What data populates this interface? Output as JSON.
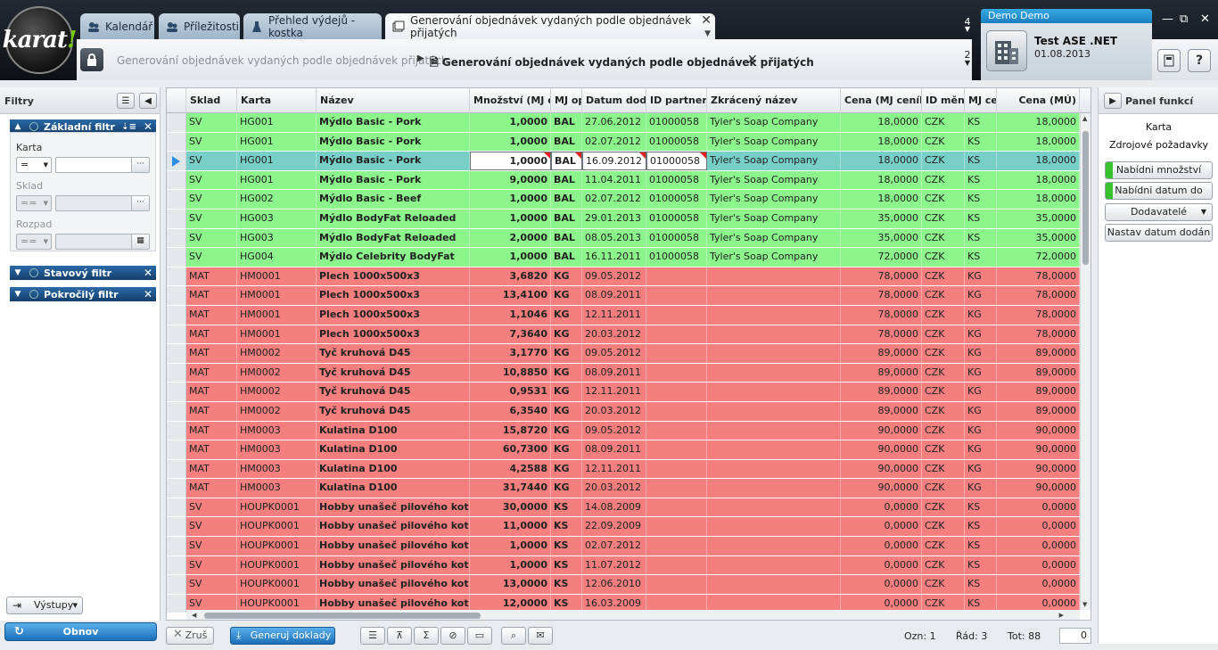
{
  "app": {
    "logo_text": "karat",
    "tabs": [
      {
        "label": "Kalendář",
        "icon": "people-icon"
      },
      {
        "label": "Příležitosti",
        "icon": "people-icon"
      },
      {
        "label": "Přehled výdejů - kostka",
        "icon": "flask-icon"
      },
      {
        "label": "Generování objednávek vydaných podle objednávek přijatých",
        "icon": "window-icon",
        "close": "✕",
        "arrow": "▼"
      }
    ],
    "tab_count": "4",
    "crumb_count": "2",
    "breadcrumb": {
      "parent": "Generování objednávek vydaných podle objednávek přijatých",
      "current": "Generování objednávek vydaných podle objednávek přijatých",
      "close": "✕"
    },
    "user": {
      "name": "Demo Demo",
      "company": "Test ASE .NET",
      "date": "01.08.2013"
    },
    "window_controls": {
      "minimize": "—",
      "restore": "⧉",
      "close": "✕"
    },
    "help": "?"
  },
  "filters": {
    "title": "Filtry",
    "basic": {
      "title": "Základní filtr",
      "fields": [
        {
          "label": "Karta",
          "operator": "=",
          "value": "",
          "disabled": false,
          "button": "···"
        },
        {
          "label": "Sklad",
          "operator": "==",
          "value": "",
          "disabled": true,
          "button": "···"
        },
        {
          "label": "Rozpad",
          "operator": "==",
          "value": "",
          "disabled": true,
          "button": "▦"
        }
      ]
    },
    "state": {
      "title": "Stavový filtr"
    },
    "advanced": {
      "title": "Pokročilý filtr"
    },
    "vystupy": "Výstupy",
    "obnov": "Obnov"
  },
  "grid": {
    "columns": [
      "Sklad",
      "Karta",
      "Název",
      "Množství (MJ op)",
      "MJ op",
      "Datum dodán",
      "ID partnera",
      "Zkrácený název",
      "Cena (MJ ceníku)",
      "ID měny",
      "MJ cen",
      "Cena (MÚ)"
    ],
    "rows": [
      {
        "s": "g",
        "c": [
          "SV",
          "HG001",
          "Mýdlo Basic - Pork",
          "1,0000",
          "BAL",
          "27.06.2012",
          "01000058",
          "Tyler's Soap Company",
          "18,0000",
          "CZK",
          "KS",
          "18,0000"
        ]
      },
      {
        "s": "g",
        "c": [
          "SV",
          "HG001",
          "Mýdlo Basic - Pork",
          "1,0000",
          "BAL",
          "02.07.2012",
          "01000058",
          "Tyler's Soap Company",
          "18,0000",
          "CZK",
          "KS",
          "18,0000"
        ]
      },
      {
        "s": "sel",
        "c": [
          "SV",
          "HG001",
          "Mýdlo Basic - Pork",
          "1,0000",
          "BAL",
          "16.09.2012",
          "01000058",
          "Tyler's Soap Company",
          "18,0000",
          "CZK",
          "KS",
          "18,0000"
        ]
      },
      {
        "s": "g",
        "c": [
          "SV",
          "HG001",
          "Mýdlo Basic - Pork",
          "9,0000",
          "BAL",
          "11.04.2011",
          "01000058",
          "Tyler's Soap Company",
          "18,0000",
          "CZK",
          "KS",
          "18,0000"
        ]
      },
      {
        "s": "g",
        "c": [
          "SV",
          "HG002",
          "Mýdlo Basic - Beef",
          "1,0000",
          "BAL",
          "02.07.2012",
          "01000058",
          "Tyler's Soap Company",
          "18,0000",
          "CZK",
          "KS",
          "18,0000"
        ]
      },
      {
        "s": "g",
        "c": [
          "SV",
          "HG003",
          "Mýdlo BodyFat Reloaded",
          "1,0000",
          "BAL",
          "29.01.2013",
          "01000058",
          "Tyler's Soap Company",
          "35,0000",
          "CZK",
          "KS",
          "35,0000"
        ]
      },
      {
        "s": "g",
        "c": [
          "SV",
          "HG003",
          "Mýdlo BodyFat Reloaded",
          "2,0000",
          "BAL",
          "08.05.2013",
          "01000058",
          "Tyler's Soap Company",
          "35,0000",
          "CZK",
          "KS",
          "35,0000"
        ]
      },
      {
        "s": "g",
        "c": [
          "SV",
          "HG004",
          "Mýdlo Celebrity BodyFat",
          "1,0000",
          "BAL",
          "16.11.2011",
          "01000058",
          "Tyler's Soap Company",
          "72,0000",
          "CZK",
          "KS",
          "72,0000"
        ]
      },
      {
        "s": "r",
        "c": [
          "MAT",
          "HM0001",
          "Plech 1000x500x3",
          "3,6820",
          "KG",
          "09.05.2012",
          "",
          "",
          "78,0000",
          "CZK",
          "KG",
          "78,0000"
        ]
      },
      {
        "s": "r",
        "c": [
          "MAT",
          "HM0001",
          "Plech 1000x500x3",
          "13,4100",
          "KG",
          "08.09.2011",
          "",
          "",
          "78,0000",
          "CZK",
          "KG",
          "78,0000"
        ]
      },
      {
        "s": "r",
        "c": [
          "MAT",
          "HM0001",
          "Plech 1000x500x3",
          "1,1046",
          "KG",
          "12.11.2011",
          "",
          "",
          "78,0000",
          "CZK",
          "KG",
          "78,0000"
        ]
      },
      {
        "s": "r",
        "c": [
          "MAT",
          "HM0001",
          "Plech 1000x500x3",
          "7,3640",
          "KG",
          "20.03.2012",
          "",
          "",
          "78,0000",
          "CZK",
          "KG",
          "78,0000"
        ]
      },
      {
        "s": "r",
        "c": [
          "MAT",
          "HM0002",
          "Tyč kruhová D45",
          "3,1770",
          "KG",
          "09.05.2012",
          "",
          "",
          "89,0000",
          "CZK",
          "KG",
          "89,0000"
        ]
      },
      {
        "s": "r",
        "c": [
          "MAT",
          "HM0002",
          "Tyč kruhová D45",
          "10,8850",
          "KG",
          "08.09.2011",
          "",
          "",
          "89,0000",
          "CZK",
          "KG",
          "89,0000"
        ]
      },
      {
        "s": "r",
        "c": [
          "MAT",
          "HM0002",
          "Tyč kruhová D45",
          "0,9531",
          "KG",
          "12.11.2011",
          "",
          "",
          "89,0000",
          "CZK",
          "KG",
          "89,0000"
        ]
      },
      {
        "s": "r",
        "c": [
          "MAT",
          "HM0002",
          "Tyč kruhová D45",
          "6,3540",
          "KG",
          "20.03.2012",
          "",
          "",
          "89,0000",
          "CZK",
          "KG",
          "89,0000"
        ]
      },
      {
        "s": "r",
        "c": [
          "MAT",
          "HM0003",
          "Kulatina D100",
          "15,8720",
          "KG",
          "09.05.2012",
          "",
          "",
          "90,0000",
          "CZK",
          "KG",
          "90,0000"
        ]
      },
      {
        "s": "r",
        "c": [
          "MAT",
          "HM0003",
          "Kulatina D100",
          "60,7300",
          "KG",
          "08.09.2011",
          "",
          "",
          "90,0000",
          "CZK",
          "KG",
          "90,0000"
        ]
      },
      {
        "s": "r",
        "c": [
          "MAT",
          "HM0003",
          "Kulatina D100",
          "4,2588",
          "KG",
          "12.11.2011",
          "",
          "",
          "90,0000",
          "CZK",
          "KG",
          "90,0000"
        ]
      },
      {
        "s": "r",
        "c": [
          "MAT",
          "HM0003",
          "Kulatina D100",
          "31,7440",
          "KG",
          "20.03.2012",
          "",
          "",
          "90,0000",
          "CZK",
          "KG",
          "90,0000"
        ]
      },
      {
        "s": "r",
        "c": [
          "SV",
          "HOUPK0001",
          "Hobby unašeč pilového kotouče",
          "30,0000",
          "KS",
          "14.08.2009",
          "",
          "",
          "0,0000",
          "CZK",
          "KS",
          "0,0000"
        ]
      },
      {
        "s": "r",
        "c": [
          "SV",
          "HOUPK0001",
          "Hobby unašeč pilového kotouče",
          "11,0000",
          "KS",
          "22.09.2009",
          "",
          "",
          "0,0000",
          "CZK",
          "KS",
          "0,0000"
        ]
      },
      {
        "s": "r",
        "c": [
          "SV",
          "HOUPK0001",
          "Hobby unašeč pilového kotouče",
          "1,0000",
          "KS",
          "02.07.2012",
          "",
          "",
          "0,0000",
          "CZK",
          "KS",
          "0,0000"
        ]
      },
      {
        "s": "r",
        "c": [
          "SV",
          "HOUPK0001",
          "Hobby unašeč pilového kotouče",
          "1,0000",
          "KS",
          "11.07.2012",
          "",
          "",
          "0,0000",
          "CZK",
          "KS",
          "0,0000"
        ]
      },
      {
        "s": "r",
        "c": [
          "SV",
          "HOUPK0001",
          "Hobby unašeč pilového kotouče",
          "13,0000",
          "KS",
          "12.06.2010",
          "",
          "",
          "0,0000",
          "CZK",
          "KS",
          "0,0000"
        ]
      },
      {
        "s": "r",
        "c": [
          "SV",
          "HOUPK0001",
          "Hobby unašeč pilového kotouče",
          "12,0000",
          "KS",
          "16.03.2009",
          "",
          "",
          "0,0000",
          "CZK",
          "KS",
          "0,0000"
        ]
      }
    ]
  },
  "bottom": {
    "zrus": "Zruš",
    "generuj": "Generuj doklady",
    "tools": [
      "☰",
      "⊼",
      "Σ",
      "⊘",
      "▭",
      "⌕",
      "✉"
    ],
    "ozn": "Ozn: 1",
    "rad": "Řád: 3",
    "tot": "Tot: 88",
    "totbox": "0"
  },
  "right_panel": {
    "title": "Panel funkcí",
    "card": "Karta",
    "source": "Zdrojové požadavky",
    "buttons": [
      {
        "label": "Nabídni množství",
        "green": true,
        "dropdown": false
      },
      {
        "label": "Nabídni datum do",
        "green": true,
        "dropdown": false
      },
      {
        "label": "Dodavatelé",
        "green": false,
        "dropdown": true
      },
      {
        "label": "Nastav datum dodán",
        "green": false,
        "dropdown": false
      }
    ]
  },
  "colors": {
    "green_row": "#8cf58b",
    "red_row": "#f47f7e",
    "selected_row": "#78cfc7",
    "accent": "#1b6fb8"
  }
}
